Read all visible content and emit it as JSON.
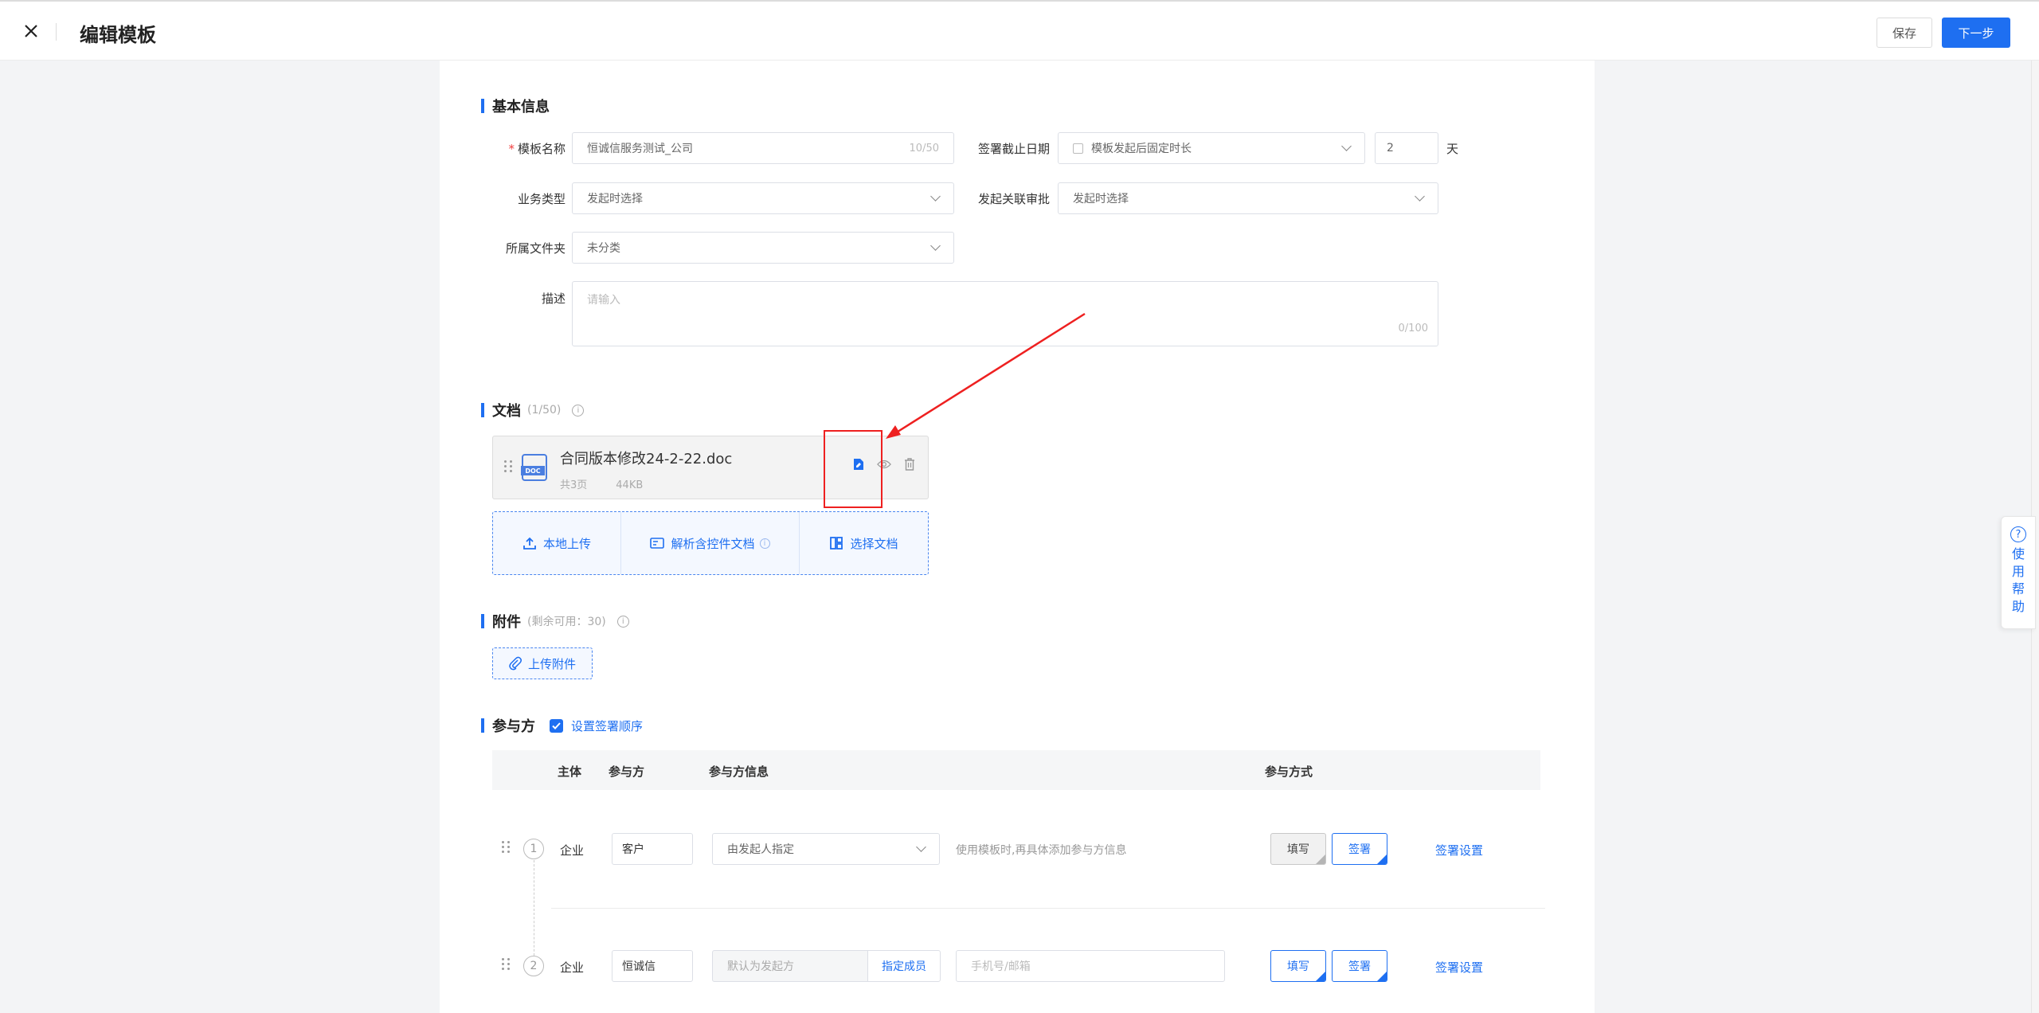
{
  "header": {
    "title": "编辑模板",
    "save_label": "保存",
    "next_label": "下一步"
  },
  "basic": {
    "section_title": "基本信息",
    "template_name_label": "模板名称",
    "template_name_value": "恒诚信服务测试_公司",
    "template_name_counter": "10/50",
    "deadline_label": "签署截止日期",
    "deadline_mode": "模板发起后固定时长",
    "deadline_days": "2",
    "deadline_unit": "天",
    "business_type_label": "业务类型",
    "business_type_value": "发起时选择",
    "approval_label": "发起关联审批",
    "approval_value": "发起时选择",
    "folder_label": "所属文件夹",
    "folder_value": "未分类",
    "desc_label": "描述",
    "desc_placeholder": "请输入",
    "desc_counter": "0/100"
  },
  "documents": {
    "section_title": "文档",
    "count": "(1/50)",
    "file": {
      "name": "合同版本修改24-2-22.doc",
      "pages": "共3页",
      "size": "44KB",
      "type_tag": "DOC"
    },
    "upload_options": [
      "本地上传",
      "解析含控件文档",
      "选择文档"
    ]
  },
  "attachments": {
    "section_title": "附件",
    "remaining": "(剩余可用：30)",
    "upload_label": "上传附件"
  },
  "participants": {
    "section_title": "参与方",
    "order_label": "设置签署顺序",
    "columns": [
      "主体",
      "参与方",
      "参与方信息",
      "参与方式"
    ],
    "rows": [
      {
        "index": "1",
        "entity": "企业",
        "name": "客户",
        "info_select": "由发起人指定",
        "hint": "使用模板时,再具体添加参与方信息",
        "fill_label": "填写",
        "sign_label": "签署",
        "settings_label": "签署设置"
      },
      {
        "index": "2",
        "entity": "企业",
        "name": "恒诚信",
        "info_default": "默认为发起方",
        "assign_label": "指定成员",
        "contact_placeholder": "手机号/邮箱",
        "fill_label": "填写",
        "sign_label": "签署",
        "settings_label": "签署设置"
      }
    ]
  },
  "help": {
    "label": "使用帮助"
  },
  "colors": {
    "accent": "#1e6ff1",
    "annotation": "#ee2020"
  }
}
